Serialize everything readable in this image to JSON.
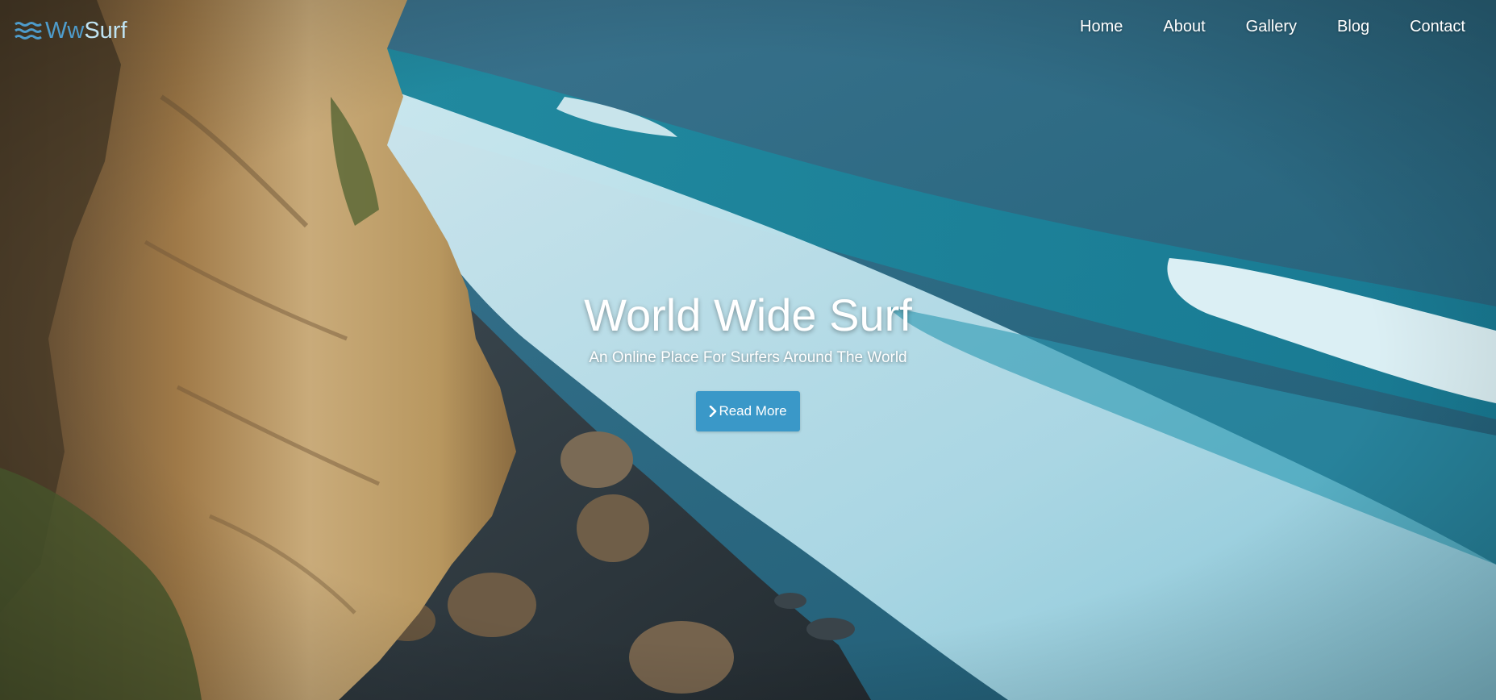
{
  "brand": {
    "ww": "Ww",
    "surf": "Surf",
    "icon": "waves-icon"
  },
  "nav": {
    "items": [
      {
        "label": "Home"
      },
      {
        "label": "About"
      },
      {
        "label": "Gallery"
      },
      {
        "label": "Blog"
      },
      {
        "label": "Contact"
      }
    ]
  },
  "hero": {
    "title": "World Wide Surf",
    "subtitle": "An Online Place For Surfers Around The World",
    "button_label": "Read More",
    "button_icon": "chevron-right-icon",
    "background": "aerial photo of cliff and ocean waves"
  },
  "colors": {
    "accent": "#3a98c8",
    "brand_dark": "#4e9ccc",
    "brand_light": "#bfe3f2",
    "ocean": "#2f6f86",
    "cliff": "#b08a55"
  }
}
